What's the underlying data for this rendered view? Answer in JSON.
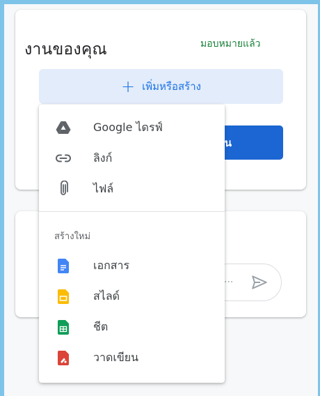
{
  "work_card": {
    "title": "งานของคุณ",
    "status": "มอบหมายแล้ว",
    "add_create_label": "เพิ่มหรือสร้าง",
    "add_create_icon": "plus-icon",
    "primary_button_label": "น"
  },
  "comment_box": {
    "placeholder_dots": "...",
    "send_icon": "send-icon"
  },
  "menu": {
    "attach_items": [
      {
        "label": "Google ไดรฟ์",
        "icon": "google-drive-icon"
      },
      {
        "label": "ลิงก์",
        "icon": "link-icon"
      },
      {
        "label": "ไฟล์",
        "icon": "attachment-icon"
      }
    ],
    "create_section_label": "สร้างใหม่",
    "create_items": [
      {
        "label": "เอกสาร",
        "icon": "docs-icon",
        "color": "#4285f4"
      },
      {
        "label": "สไลด์",
        "icon": "slides-icon",
        "color": "#fbbc04"
      },
      {
        "label": "ชีต",
        "icon": "sheets-icon",
        "color": "#0f9d58"
      },
      {
        "label": "วาดเขียน",
        "icon": "drawings-icon",
        "color": "#db4437"
      }
    ]
  },
  "colors": {
    "accent": "#1a73e8",
    "button_fill": "#1b66d2",
    "button_tint": "#e3ecfa",
    "status_green": "#188038"
  }
}
